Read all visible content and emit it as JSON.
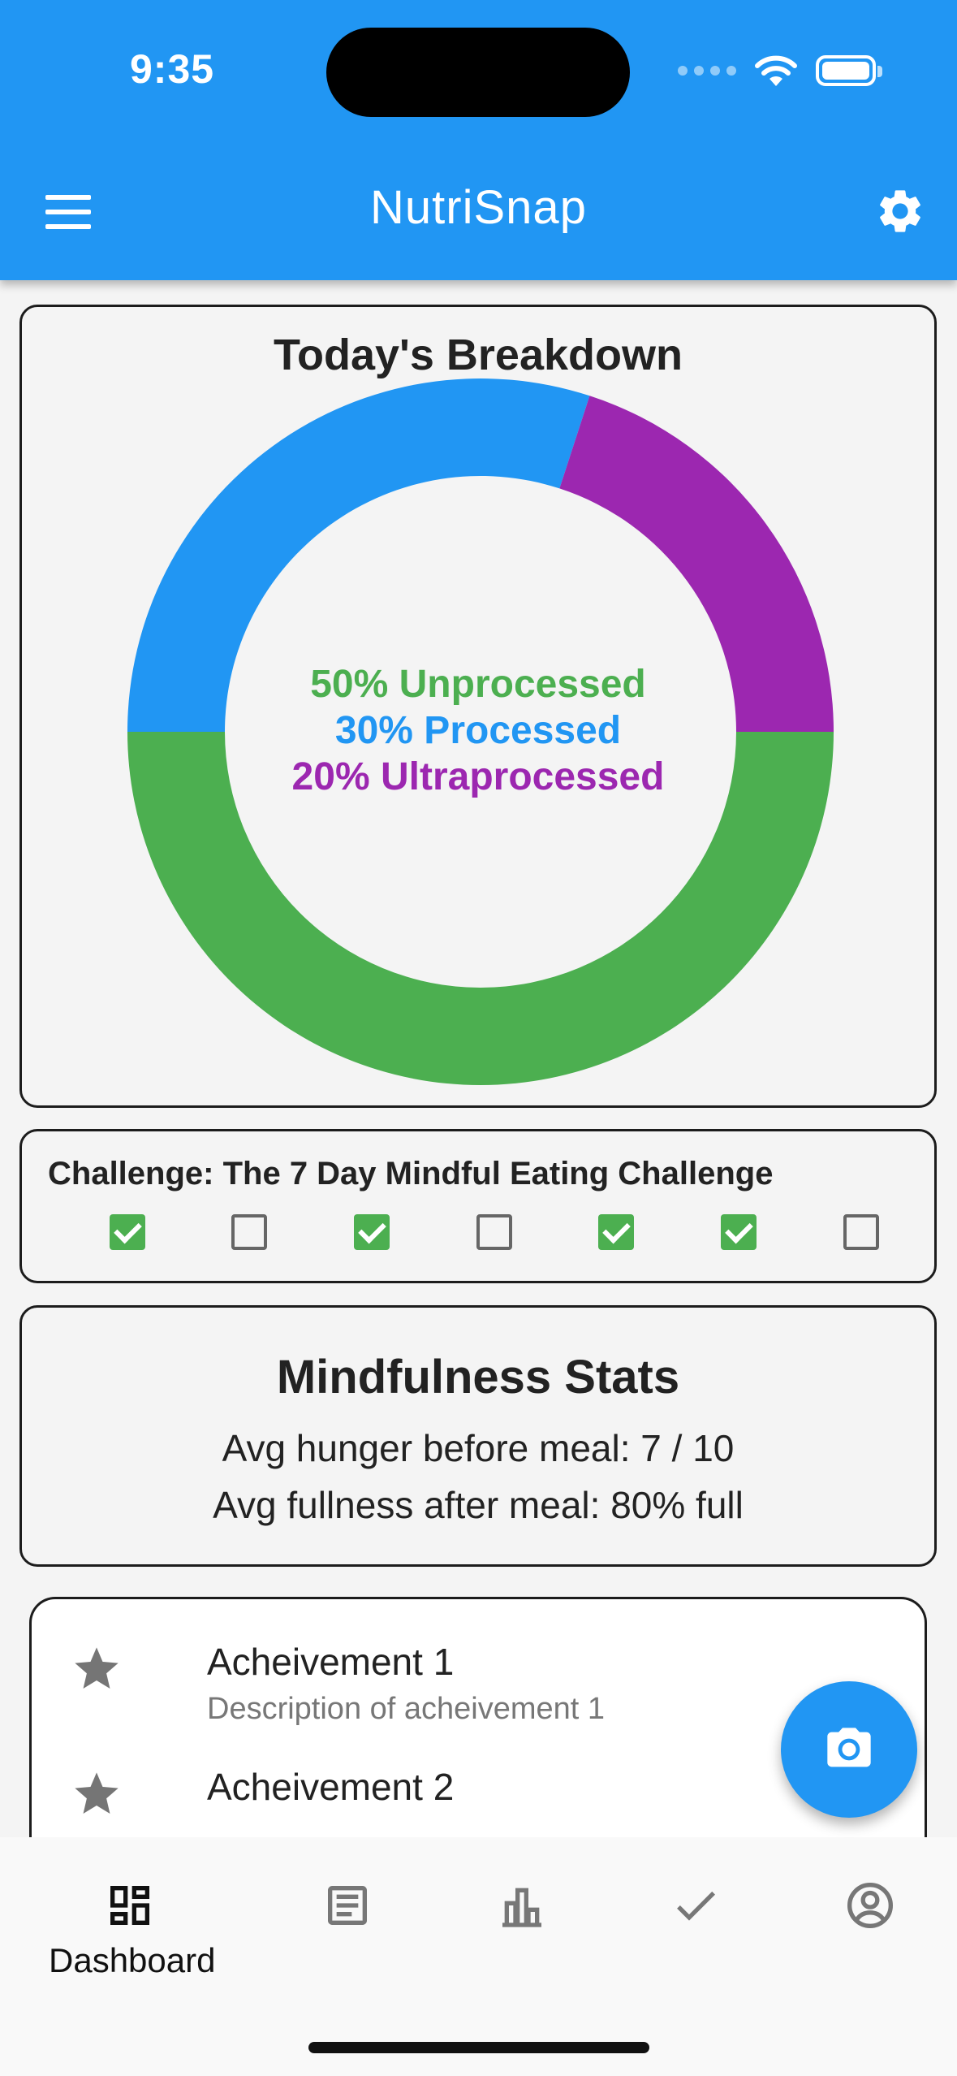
{
  "status_bar": {
    "time": "9:35"
  },
  "app_bar": {
    "title": "NutriSnap"
  },
  "breakdown": {
    "title": "Today's Breakdown",
    "labels": {
      "unprocessed": "50% Unprocessed",
      "processed": "30% Processed",
      "ultraprocessed": "20% Ultraprocessed"
    }
  },
  "chart_data": {
    "type": "pie",
    "title": "Today's Breakdown",
    "slices": [
      {
        "name": "Unprocessed",
        "value": 50,
        "color": "#4caf50"
      },
      {
        "name": "Processed",
        "value": 30,
        "color": "#2196f3"
      },
      {
        "name": "Ultraprocessed",
        "value": 20,
        "color": "#9c27b0"
      }
    ]
  },
  "challenge": {
    "title": "Challenge: The 7 Day Mindful Eating Challenge",
    "days": [
      true,
      false,
      true,
      false,
      true,
      true,
      false
    ]
  },
  "stats": {
    "title": "Mindfulness Stats",
    "hunger": "Avg hunger before meal: 7 / 10",
    "fullness": "Avg fullness after meal: 80% full"
  },
  "achievements": [
    {
      "title": "Acheivement 1",
      "description": "Description of acheivement 1",
      "icon": "star-icon"
    },
    {
      "title": "Acheivement 2",
      "description": "",
      "icon": "star-icon"
    }
  ],
  "fab": {
    "icon": "camera-icon"
  },
  "bottom_nav": {
    "items": [
      {
        "label": "Dashboard",
        "icon": "dashboard-icon",
        "active": true
      },
      {
        "label": "",
        "icon": "journal-icon",
        "active": false
      },
      {
        "label": "",
        "icon": "bar-chart-icon",
        "active": false
      },
      {
        "label": "",
        "icon": "check-icon",
        "active": false
      },
      {
        "label": "",
        "icon": "profile-icon",
        "active": false
      }
    ]
  },
  "colors": {
    "primary": "#2196f3",
    "unprocessed": "#4caf50",
    "processed": "#2196f3",
    "ultraprocessed": "#9c27b0"
  }
}
